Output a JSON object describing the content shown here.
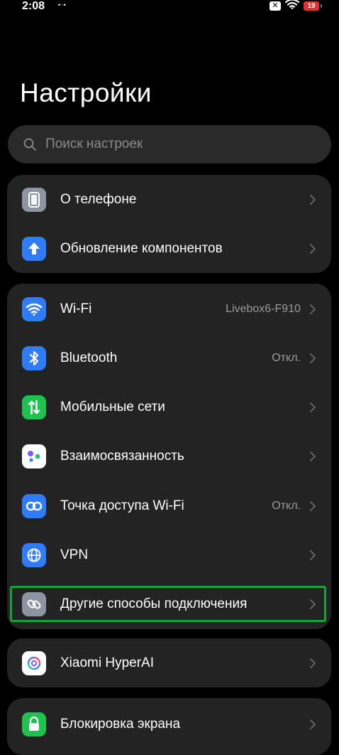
{
  "status_bar": {
    "time": "2:08",
    "dots": "•ᐧ•",
    "sim_icon_glyph": "✕",
    "battery_level": "19",
    "battery_color": "#e0312c"
  },
  "page_title": "Настройки",
  "search": {
    "placeholder": "Поиск настроек"
  },
  "groups": [
    {
      "items": [
        {
          "label": "О телефоне",
          "value": "",
          "icon": "phone-icon",
          "icon_color": "#8d95a3"
        },
        {
          "label": "Обновление компонентов",
          "value": "",
          "icon": "arrow-up-icon",
          "icon_color": "#2f7cf6"
        }
      ]
    },
    {
      "items": [
        {
          "label": "Wi-Fi",
          "value": "Livebox6-F910",
          "icon": "wifi-icon",
          "icon_color": "#2f7cf6"
        },
        {
          "label": "Bluetooth",
          "value": "Откл.",
          "icon": "bluetooth-icon",
          "icon_color": "#2f7cf6"
        },
        {
          "label": "Мобильные сети",
          "value": "",
          "icon": "mobile-data-icon",
          "icon_color": "#1fc24f"
        },
        {
          "label": "Взаимосвязанность",
          "value": "",
          "icon": "interconnect-icon",
          "icon_color": "#ffffff"
        },
        {
          "label": "Точка доступа Wi-Fi",
          "value": "Откл.",
          "icon": "hotspot-icon",
          "icon_color": "#2f7cf6"
        },
        {
          "label": "VPN",
          "value": "",
          "icon": "globe-icon",
          "icon_color": "#2f7cf6"
        },
        {
          "label": "Другие способы подключения",
          "value": "",
          "icon": "link-icon",
          "icon_color": "#8d95a3"
        }
      ]
    },
    {
      "items": [
        {
          "label": "Xiaomi HyperAI",
          "value": "",
          "icon": "hyperai-icon",
          "icon_color": "#ffffff"
        }
      ]
    },
    {
      "items": [
        {
          "label": "Блокировка экрана",
          "value": "",
          "icon": "lock-icon",
          "icon_color": "#1fc24f"
        }
      ]
    }
  ]
}
